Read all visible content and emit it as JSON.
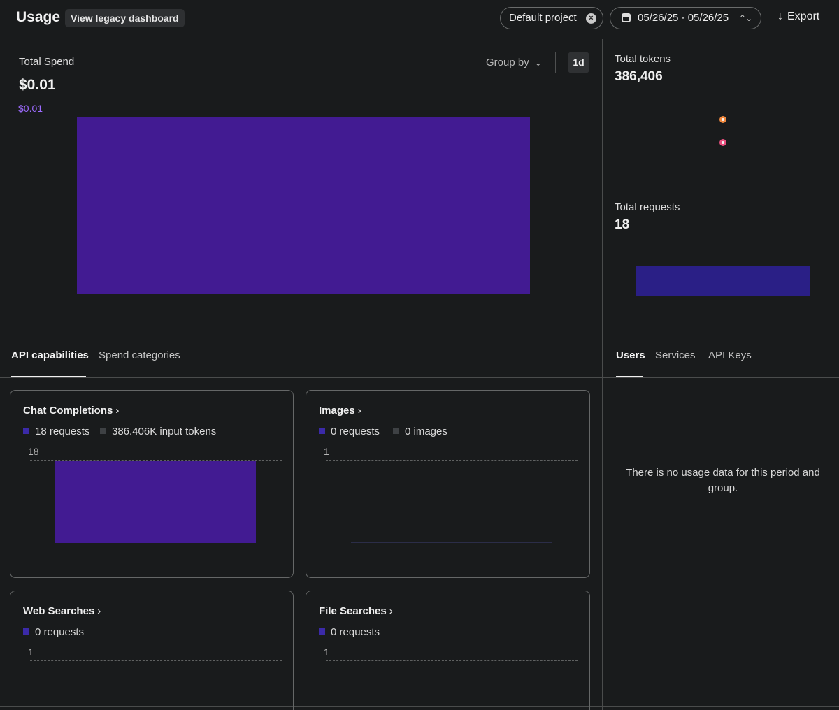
{
  "header": {
    "title": "Usage",
    "legacy_button": "View legacy dashboard",
    "project": "Default project",
    "date_range": "05/26/25 - 05/26/25",
    "export": "Export"
  },
  "spend": {
    "label": "Total Spend",
    "value": "$0.01",
    "group_by": "Group by",
    "interval": "1d",
    "reference_label": "$0.01"
  },
  "tokens": {
    "label": "Total tokens",
    "value": "386,406"
  },
  "requests": {
    "label": "Total requests",
    "value": "18"
  },
  "tabs_left": [
    "API capabilities",
    "Spend categories"
  ],
  "tabs_right": [
    "Users",
    "Services",
    "API Keys"
  ],
  "cards": {
    "chat": {
      "title": "Chat Completions",
      "legend1": "18 requests",
      "legend2": "386.406K input tokens",
      "axis": "18"
    },
    "images": {
      "title": "Images",
      "legend1": "0 requests",
      "legend2": "0 images",
      "axis": "1"
    },
    "web": {
      "title": "Web Searches",
      "legend1": "0 requests",
      "axis": "1"
    },
    "file": {
      "title": "File Searches",
      "legend1": "0 requests",
      "axis": "1"
    }
  },
  "empty_state": "There is no usage data for this period and group.",
  "colors": {
    "bar_purple": "#421b92",
    "request_bar": "#2a1f86",
    "accent_purple_text": "#9d6bff",
    "dot_orange": "#f0883e",
    "dot_pink": "#e84f7e"
  },
  "chart_data": [
    {
      "type": "bar",
      "title": "Total Spend",
      "categories": [
        "05/26/25"
      ],
      "values": [
        0.01
      ],
      "ylim": [
        0,
        0.01
      ]
    },
    {
      "type": "bar",
      "title": "Total requests",
      "categories": [
        "05/26/25"
      ],
      "values": [
        18
      ]
    },
    {
      "type": "bar",
      "title": "Chat Completions",
      "categories": [
        "05/26/25"
      ],
      "values": [
        18
      ],
      "ylim": [
        0,
        18
      ]
    },
    {
      "type": "bar",
      "title": "Images",
      "categories": [
        "05/26/25"
      ],
      "values": [
        0
      ],
      "ylim": [
        0,
        1
      ]
    }
  ]
}
